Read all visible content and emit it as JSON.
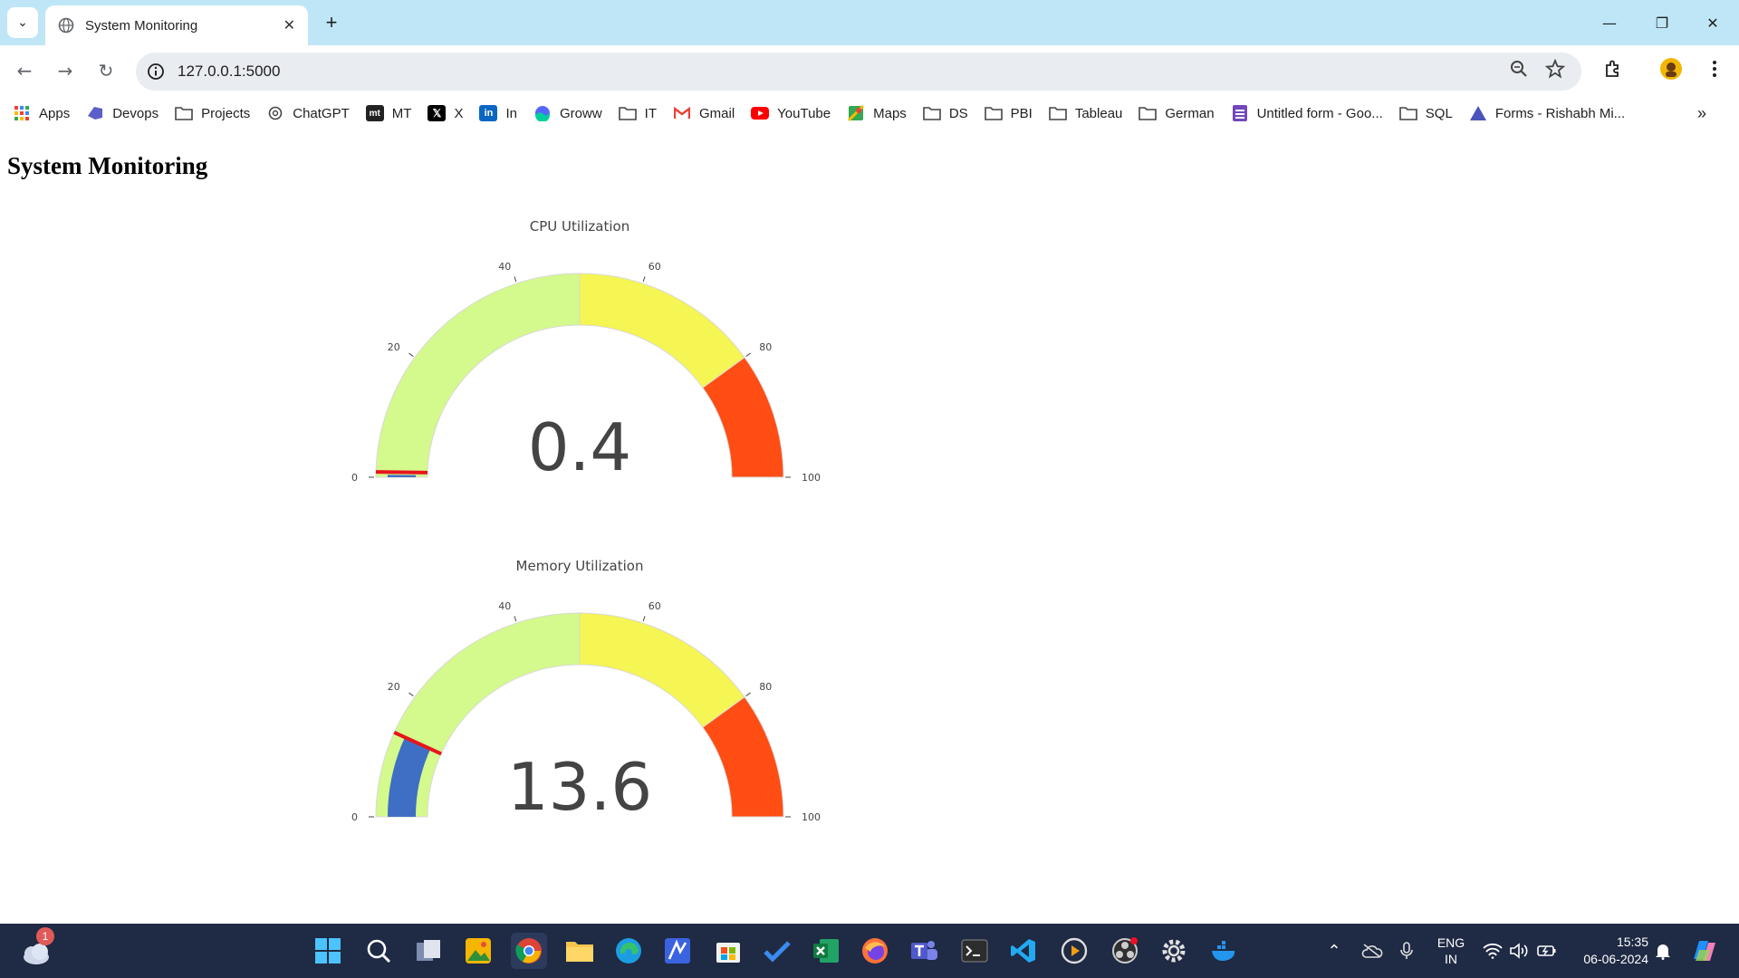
{
  "browser": {
    "tab_title": "System Monitoring",
    "url": "127.0.0.1:5000",
    "bookmarks": [
      {
        "label": "Apps",
        "icon": "apps-grid-icon"
      },
      {
        "label": "Devops",
        "icon": "devops-icon"
      },
      {
        "label": "Projects",
        "icon": "folder-icon"
      },
      {
        "label": "ChatGPT",
        "icon": "chatgpt-icon"
      },
      {
        "label": "MT",
        "icon": "mt-icon"
      },
      {
        "label": "X",
        "icon": "x-icon"
      },
      {
        "label": "In",
        "icon": "linkedin-icon"
      },
      {
        "label": "Groww",
        "icon": "groww-icon"
      },
      {
        "label": "IT",
        "icon": "folder-icon"
      },
      {
        "label": "Gmail",
        "icon": "gmail-icon"
      },
      {
        "label": "YouTube",
        "icon": "youtube-icon"
      },
      {
        "label": "Maps",
        "icon": "maps-icon"
      },
      {
        "label": "DS",
        "icon": "folder-icon"
      },
      {
        "label": "PBI",
        "icon": "folder-icon"
      },
      {
        "label": "Tableau",
        "icon": "folder-icon"
      },
      {
        "label": "German",
        "icon": "folder-icon"
      },
      {
        "label": "Untitled form - Goo...",
        "icon": "google-forms-icon"
      },
      {
        "label": "SQL",
        "icon": "folder-icon"
      },
      {
        "label": "Forms - Rishabh Mi...",
        "icon": "forms-icon"
      }
    ]
  },
  "page": {
    "heading": "System Monitoring"
  },
  "chart_data": [
    {
      "type": "gauge",
      "title": "CPU Utilization",
      "value": 0.4,
      "value_text": "0.4",
      "range": [
        0,
        100
      ],
      "ticks": [
        "0",
        "20",
        "40",
        "60",
        "80",
        "100"
      ],
      "tick_values": [
        0,
        20,
        40,
        60,
        80,
        100
      ],
      "steps": [
        {
          "range": [
            0,
            50
          ],
          "color": "#d4f98c"
        },
        {
          "range": [
            50,
            80
          ],
          "color": "#f5f553"
        },
        {
          "range": [
            80,
            100
          ],
          "color": "#ff4d14"
        }
      ],
      "bar_color": "#3f6fc4",
      "threshold": {
        "value": 0.4,
        "color": "#e8141c"
      }
    },
    {
      "type": "gauge",
      "title": "Memory Utilization",
      "value": 13.6,
      "value_text": "13.6",
      "range": [
        0,
        100
      ],
      "ticks": [
        "0",
        "20",
        "40",
        "60",
        "80",
        "100"
      ],
      "tick_values": [
        0,
        20,
        40,
        60,
        80,
        100
      ],
      "steps": [
        {
          "range": [
            0,
            50
          ],
          "color": "#d4f98c"
        },
        {
          "range": [
            50,
            80
          ],
          "color": "#f5f553"
        },
        {
          "range": [
            80,
            100
          ],
          "color": "#ff4d14"
        }
      ],
      "bar_color": "#3f6fc4",
      "threshold": {
        "value": 13.6,
        "color": "#e8141c"
      }
    }
  ],
  "taskbar": {
    "weather_badge": "1",
    "language": "ENG",
    "region": "IN",
    "time": "15:35",
    "date": "06-06-2024"
  }
}
